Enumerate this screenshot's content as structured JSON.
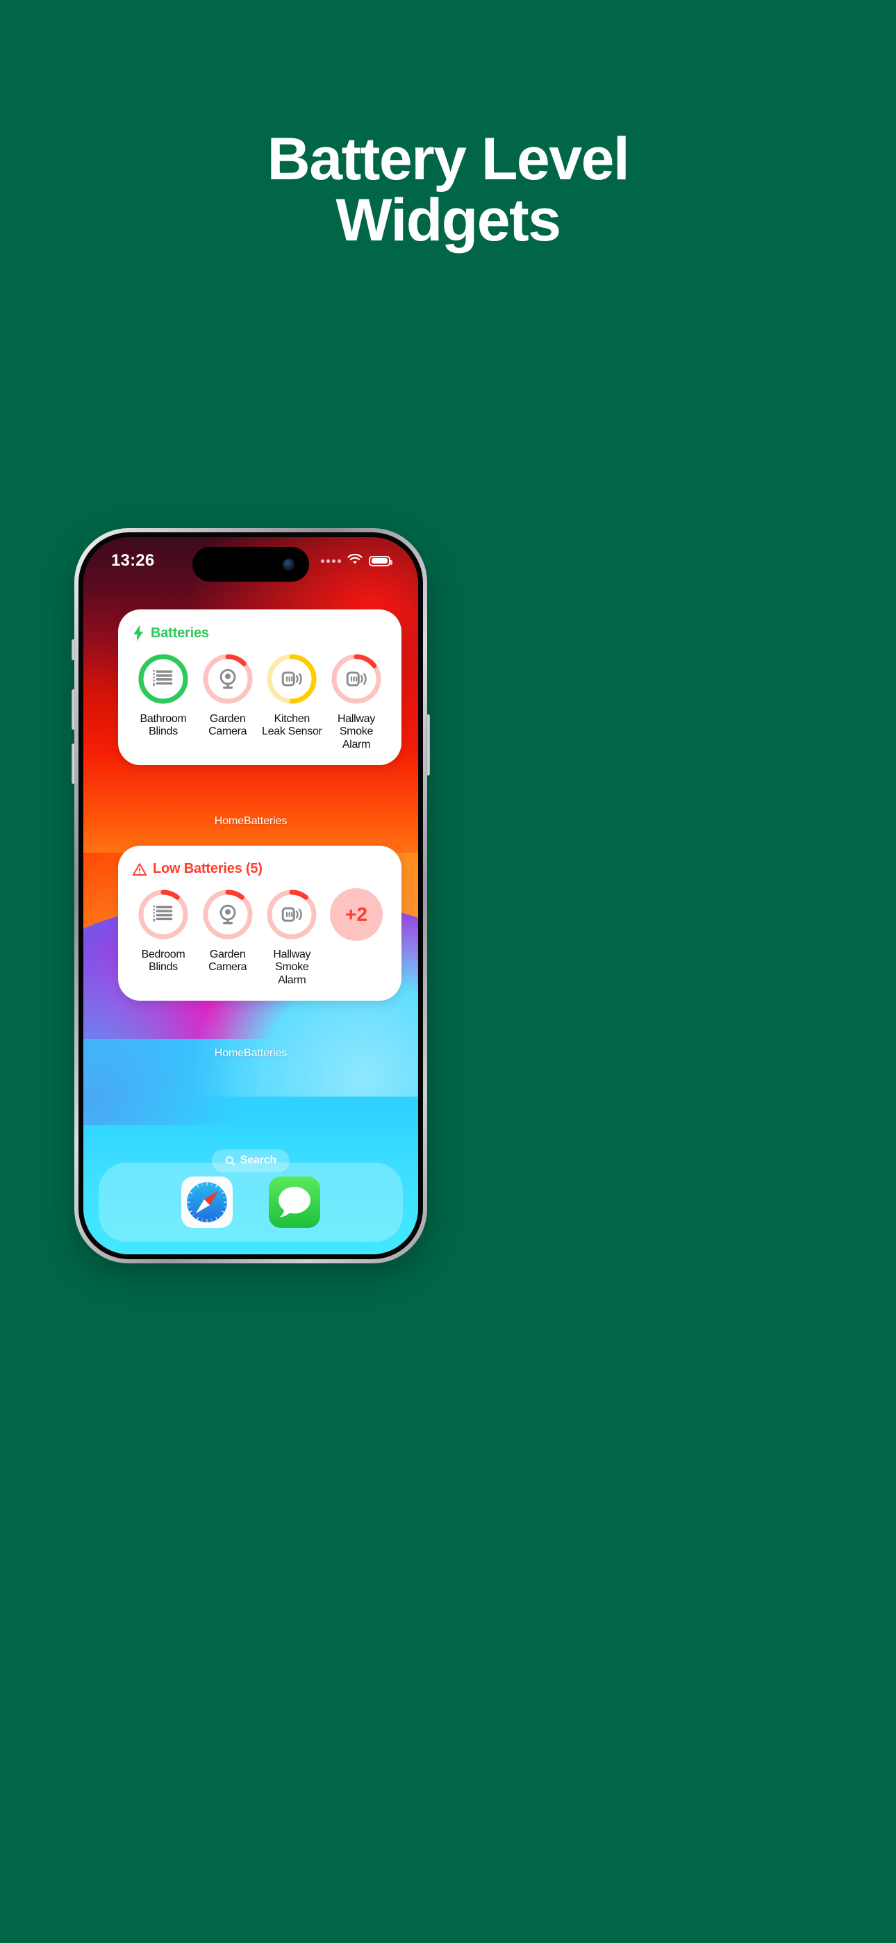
{
  "theme": {
    "background": "#006647",
    "headline_color": "#ffffff",
    "accent_green": "#2ec95a",
    "accent_red": "#fc3d2e",
    "accent_yellow": "#ffcc00",
    "ring_track_red": "#fcc3c0",
    "ring_track_yellow": "#fde9a8",
    "widget_bg": "#ffffff"
  },
  "headline": {
    "line1": "Battery Level",
    "line2": "Widgets"
  },
  "phone": {
    "status_bar": {
      "time": "13:26",
      "signal_icon": "signal-dots-icon",
      "wifi_icon": "wifi-icon",
      "battery_icon": "battery-icon",
      "battery_level_percent": 88
    },
    "dynamic_island": {
      "camera_icon": "front-camera-icon"
    },
    "widgets": [
      {
        "id": "batteries",
        "header_icon": "bolt-icon",
        "header_label": "Batteries",
        "header_color": "#2ec95a",
        "app_name": "HomeBatteries",
        "tiles": [
          {
            "label_line1": "Bathroom",
            "label_line2": "Blinds",
            "device_icon": "blinds-icon",
            "level_percent": 97,
            "ring_color": "#2ec95a",
            "track_color": "#2ec95a"
          },
          {
            "label_line1": "Garden",
            "label_line2": "Camera",
            "device_icon": "camera-icon",
            "level_percent": 13,
            "ring_color": "#fc3d2e",
            "track_color": "#fcc3c0"
          },
          {
            "label_line1": "Kitchen",
            "label_line2": "Leak Sensor",
            "device_icon": "leak-sensor-icon",
            "level_percent": 50,
            "ring_color": "#ffcc00",
            "track_color": "#fde9a8"
          },
          {
            "label_line1": "Hallway",
            "label_line2": "Smoke Alarm",
            "device_icon": "smoke-alarm-icon",
            "level_percent": 15,
            "ring_color": "#fc3d2e",
            "track_color": "#fcc3c0"
          }
        ]
      },
      {
        "id": "low-batteries",
        "header_icon": "warning-triangle-icon",
        "header_label": "Low Batteries (5)",
        "header_color": "#fc3d2e",
        "app_name": "HomeBatteries",
        "overflow_label": "+2",
        "tiles": [
          {
            "label_line1": "Bedroom",
            "label_line2": "Blinds",
            "device_icon": "blinds-icon",
            "level_percent": 11,
            "ring_color": "#fc3d2e",
            "track_color": "#fcc3c0"
          },
          {
            "label_line1": "Garden",
            "label_line2": "Camera",
            "device_icon": "camera-icon",
            "level_percent": 11,
            "ring_color": "#fc3d2e",
            "track_color": "#fcc3c0"
          },
          {
            "label_line1": "Hallway",
            "label_line2": "Smoke Alarm",
            "device_icon": "smoke-alarm-icon",
            "level_percent": 11,
            "ring_color": "#fc3d2e",
            "track_color": "#fcc3c0"
          }
        ]
      }
    ],
    "search": {
      "label": "Search",
      "icon": "search-icon"
    },
    "dock": [
      {
        "name": "Safari",
        "icon": "safari-icon"
      },
      {
        "name": "Messages",
        "icon": "messages-icon"
      }
    ]
  }
}
